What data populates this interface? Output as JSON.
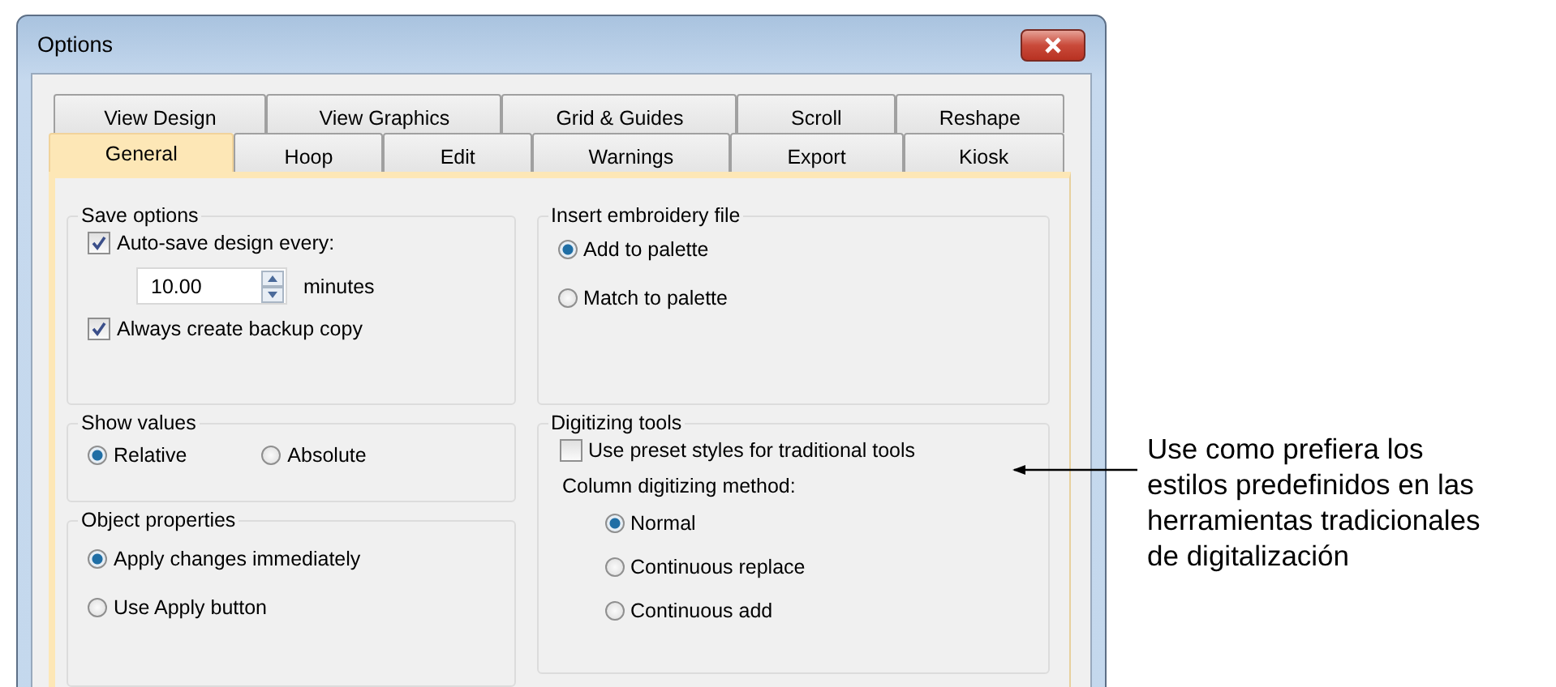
{
  "window": {
    "title": "Options"
  },
  "tab_rows": [
    [
      {
        "label": "View Design",
        "selected": false
      },
      {
        "label": "View Graphics",
        "selected": false
      },
      {
        "label": "Grid & Guides",
        "selected": false
      },
      {
        "label": "Scroll",
        "selected": false
      },
      {
        "label": "Reshape",
        "selected": false
      }
    ],
    [
      {
        "label": "General",
        "selected": true
      },
      {
        "label": "Hoop",
        "selected": false
      },
      {
        "label": "Edit",
        "selected": false
      },
      {
        "label": "Warnings",
        "selected": false
      },
      {
        "label": "Export",
        "selected": false
      },
      {
        "label": "Kiosk",
        "selected": false
      }
    ]
  ],
  "columns": [
    [
      {
        "title": "Save options",
        "horizontal": false,
        "controls": [
          {
            "kind": "checkbox",
            "label": "Auto-save design every:",
            "checked": true
          },
          {
            "kind": "spinner",
            "value": "10.00",
            "unit": "minutes"
          },
          {
            "kind": "checkbox",
            "label": "Always create backup copy",
            "checked": true
          }
        ]
      },
      {
        "title": "Show values",
        "horizontal": true,
        "controls": [
          {
            "kind": "radio",
            "label": "Relative",
            "selected": true
          },
          {
            "kind": "radio",
            "label": "Absolute",
            "selected": false
          }
        ]
      },
      {
        "title": "Object properties",
        "horizontal": false,
        "controls": [
          {
            "kind": "radio",
            "label": "Apply changes immediately",
            "selected": true
          },
          {
            "kind": "radio",
            "label": "Use Apply button",
            "selected": false
          }
        ]
      }
    ],
    [
      {
        "title": "Insert embroidery file",
        "horizontal": false,
        "controls": [
          {
            "kind": "radio",
            "label": "Add to palette",
            "selected": true
          },
          {
            "kind": "radio",
            "label": "Match to palette",
            "selected": false
          }
        ]
      },
      {
        "title": "Digitizing tools",
        "horizontal": false,
        "controls": [
          {
            "kind": "checkbox",
            "label": "Use preset styles for traditional tools",
            "checked": false
          },
          {
            "kind": "label",
            "label": "Column digitizing method:"
          },
          {
            "kind": "radio_list",
            "options": [
              {
                "label": "Normal",
                "selected": true
              },
              {
                "label": "Continuous replace",
                "selected": false
              },
              {
                "label": "Continuous add",
                "selected": false
              }
            ]
          }
        ]
      }
    ]
  ],
  "callout": {
    "lines": [
      "Use como prefiera los",
      "estilos predefinidos en las",
      "herramientas tradicionales",
      "de digitalización"
    ]
  }
}
